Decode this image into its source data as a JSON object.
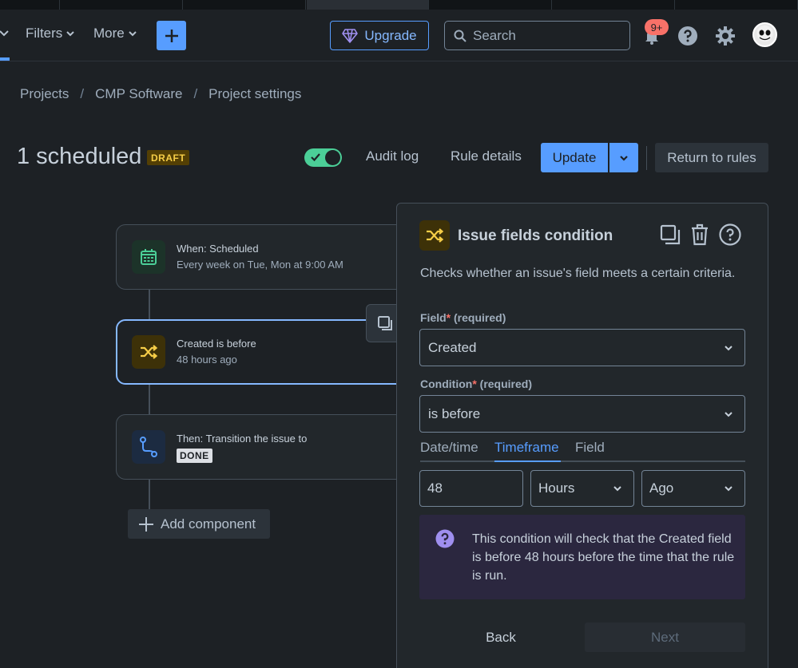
{
  "nav": {
    "filters": "Filters",
    "more": "More",
    "upgrade": "Upgrade",
    "search_placeholder": "Search",
    "notifications_badge": "9+"
  },
  "breadcrumb": [
    "Projects",
    "CMP Software",
    "Project settings"
  ],
  "header": {
    "title": "1 scheduled",
    "badge": "DRAFT",
    "toggle_on": true,
    "audit_log": "Audit log",
    "rule_details": "Rule details",
    "update": "Update",
    "return": "Return to rules"
  },
  "rule": {
    "trigger": {
      "title": "When: Scheduled",
      "subtitle": "Every week on Tue, Mon at 9:00 AM",
      "icon": "calendar-icon"
    },
    "condition": {
      "title": "Created is before",
      "subtitle": "48 hours ago",
      "icon": "shuffle-icon"
    },
    "action": {
      "title": "Then: Transition the issue to",
      "status": "DONE",
      "icon": "transition-icon"
    },
    "add_component": "Add component"
  },
  "panel": {
    "title": "Issue fields condition",
    "description": "Checks whether an issue's field meets a certain criteria.",
    "field_label": "Field",
    "field_required": "(required)",
    "field_value": "Created",
    "condition_label": "Condition",
    "condition_required": "(required)",
    "condition_value": "is before",
    "tabs": [
      "Date/time",
      "Timeframe",
      "Field"
    ],
    "active_tab": "Timeframe",
    "amount": "48",
    "unit": "Hours",
    "direction": "Ago",
    "info": "This condition will check that the Created field is before 48 hours before the time that the rule is run.",
    "back": "Back",
    "next": "Next"
  },
  "colors": {
    "accent": "#579dff",
    "toggle": "#4bce97",
    "draft": "#f5cd47",
    "badge": "#f87168",
    "info_bg": "#2b273f"
  }
}
